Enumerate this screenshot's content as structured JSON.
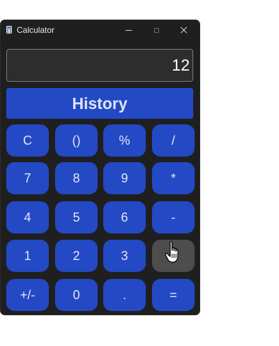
{
  "window": {
    "title": "Calculator",
    "app_icon": "calculator-icon"
  },
  "display": {
    "value": "12"
  },
  "history_button": {
    "label": "History"
  },
  "keypad": {
    "rows": [
      [
        "C",
        "()",
        "%",
        "/"
      ],
      [
        "7",
        "8",
        "9",
        "*"
      ],
      [
        "4",
        "5",
        "6",
        "-"
      ],
      [
        "1",
        "2",
        "3",
        "+"
      ],
      [
        "+/-",
        "0",
        ".",
        "="
      ]
    ],
    "hovered_key": "+"
  },
  "colors": {
    "button_blue": "#2449c5",
    "window_bg": "#1f1f1f",
    "display_bg": "#2d2d2d",
    "hover_gray": "#4d4d4d"
  },
  "cursor": {
    "icon": "hand-pointer-icon"
  }
}
